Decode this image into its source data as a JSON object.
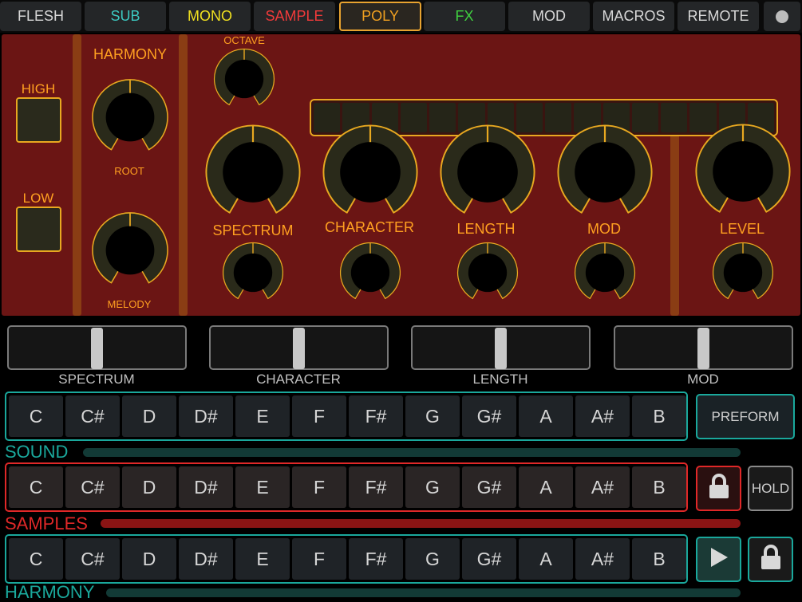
{
  "tabs": [
    {
      "label": "FLESH",
      "color": "#d8d8d8"
    },
    {
      "label": "SUB",
      "color": "#3cc8c0"
    },
    {
      "label": "MONO",
      "color": "#f0e020"
    },
    {
      "label": "SAMPLE",
      "color": "#f03a3a"
    },
    {
      "label": "POLY",
      "color": "#f0a020",
      "active": true
    },
    {
      "label": "FX",
      "color": "#40d040"
    },
    {
      "label": "MOD",
      "color": "#d8d8d8"
    },
    {
      "label": "MACROS",
      "color": "#d8d8d8"
    },
    {
      "label": "REMOTE",
      "color": "#d8d8d8"
    }
  ],
  "tabs_extra_icon": "circle-icon",
  "panel": {
    "high_label": "HIGH",
    "low_label": "LOW",
    "harmony_label": "HARMONY",
    "root_label": "ROOT",
    "melody_label": "MELODY",
    "octave_label": "OCTAVE",
    "spectrum_label": "SPECTRUM",
    "character_label": "CHARACTER",
    "length_label": "LENGTH",
    "mod_label": "MOD",
    "level_label": "LEVEL",
    "sequencer_steps": 16
  },
  "sliders": [
    {
      "label": "SPECTRUM",
      "value": 0.5
    },
    {
      "label": "CHARACTER",
      "value": 0.5
    },
    {
      "label": "LENGTH",
      "value": 0.5
    },
    {
      "label": "MOD",
      "value": 0.5
    }
  ],
  "notes": [
    "C",
    "C#",
    "D",
    "D#",
    "E",
    "F",
    "F#",
    "G",
    "G#",
    "A",
    "A#",
    "B"
  ],
  "rows": {
    "sound": {
      "label": "SOUND",
      "color": "#1aa89c"
    },
    "samples": {
      "label": "SAMPLES",
      "color": "#e02828"
    },
    "harmony": {
      "label": "HARMONY",
      "color": "#1aa89c"
    }
  },
  "buttons": {
    "preform": "PREFORM",
    "hold": "HOLD",
    "lock_icon": "lock-icon",
    "play_icon": "play-icon"
  },
  "colors": {
    "panel": "#6b1514",
    "accent": "#e8a820",
    "label": "#ffa020",
    "teal": "#1aa89c",
    "red": "#e02828"
  }
}
